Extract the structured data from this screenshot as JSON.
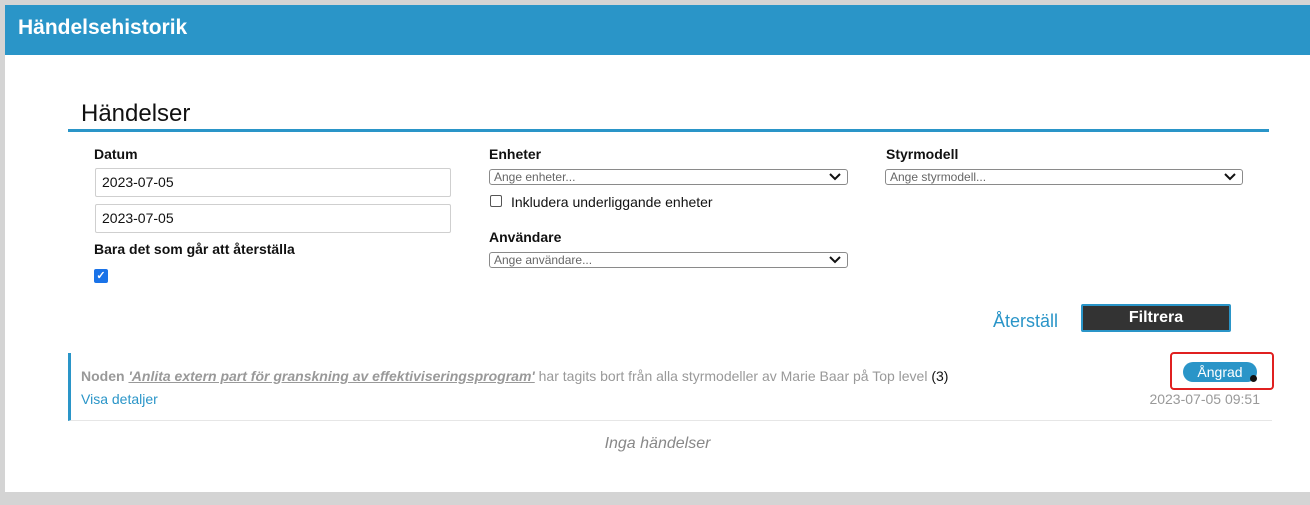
{
  "header": {
    "title": "Händelsehistorik"
  },
  "section": {
    "title": "Händelser"
  },
  "filters": {
    "date": {
      "label": "Datum",
      "from_value": "2023-07-05",
      "to_value": "2023-07-05"
    },
    "restorable_only": {
      "label": "Bara det som går att återställa",
      "checked": true
    },
    "units": {
      "label": "Enheter",
      "placeholder": "Ange enheter...",
      "include_sub_label": "Inkludera underliggande enheter",
      "include_sub_checked": false
    },
    "users": {
      "label": "Användare",
      "placeholder": "Ange användare..."
    },
    "model": {
      "label": "Styrmodell",
      "placeholder": "Ange styrmodell..."
    },
    "reset_label": "Återställ",
    "filter_label": "Filtrera"
  },
  "events": [
    {
      "prefix": "Noden",
      "node_name": "'Anlita extern part för granskning av effektiviseringsprogram'",
      "text": "har tagits bort från alla styrmodeller av Marie Baar på Top level",
      "count": "(3)",
      "details_label": "Visa detaljer",
      "timestamp": "2023-07-05 09:51",
      "undo_label": "Ångrad"
    }
  ],
  "empty_message": "Inga händelser",
  "colors": {
    "accent": "#2a95c8",
    "highlight": "#e02020",
    "button_dark": "#333333"
  }
}
